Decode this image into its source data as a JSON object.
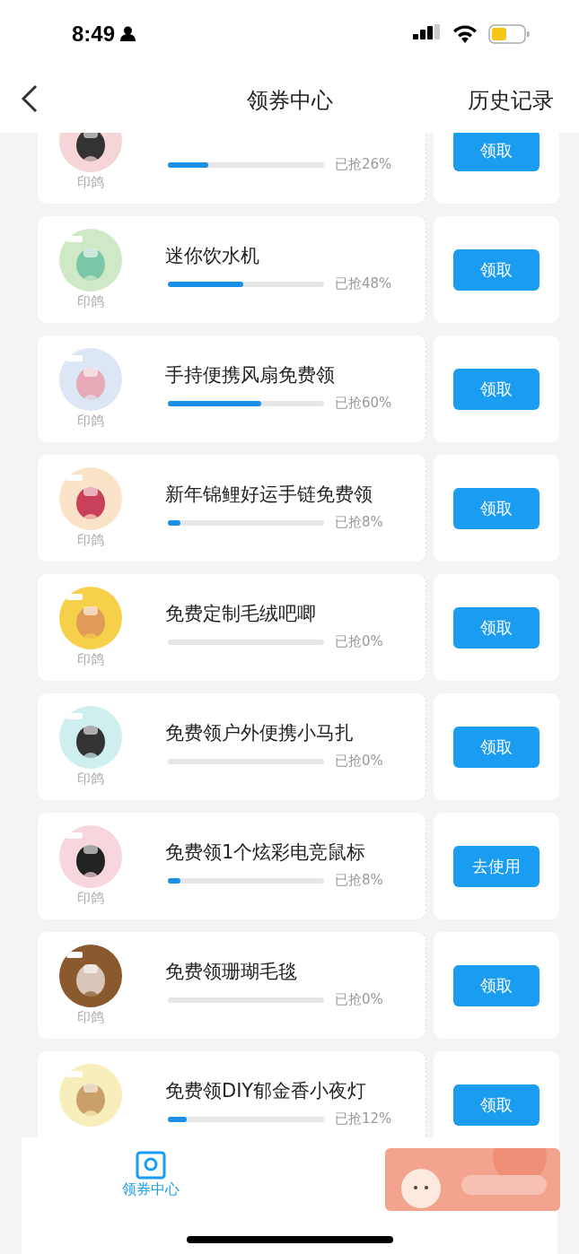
{
  "status_bar": {
    "time": "8:49"
  },
  "header": {
    "title": "领券中心",
    "action": "历史记录"
  },
  "coupons": [
    {
      "brand": "印鸽",
      "level": 0.26,
      "reading": "已抢26%",
      "button": "领取"
    },
    {
      "title": "迷你饮水机",
      "brand": "印鸽",
      "level": 0.48,
      "reading": "已抢48%",
      "button": "领取"
    },
    {
      "title": "手持便携风扇免费领",
      "brand": "印鸽",
      "level": 0.6,
      "reading": "已抢60%",
      "button": "领取"
    },
    {
      "title": "新年锦鲤好运手链免费领",
      "brand": "印鸽",
      "level": 0.08,
      "reading": "已抢8%",
      "button": "领取"
    },
    {
      "title": "免费定制毛绒吧唧",
      "brand": "印鸽",
      "level": 0,
      "reading": "已抢0%",
      "button": "领取"
    },
    {
      "title": "免费领户外便携小马扎",
      "brand": "印鸽",
      "level": 0,
      "reading": "已抢0%",
      "button": "领取"
    },
    {
      "title": "免费领1个炫彩电竞鼠标",
      "brand": "印鸽",
      "level": 0.08,
      "reading": "已抢8%",
      "button": "去使用"
    },
    {
      "title": "免费领珊瑚毛毯",
      "brand": "印鸽",
      "level": 0,
      "reading": "已抢0%",
      "button": "领取"
    },
    {
      "title": "免费领DIY郁金香小夜灯",
      "level": 0.12,
      "reading": "已抢12%",
      "button": "领取"
    }
  ],
  "bottom_tab": {
    "label": "领券中心"
  }
}
